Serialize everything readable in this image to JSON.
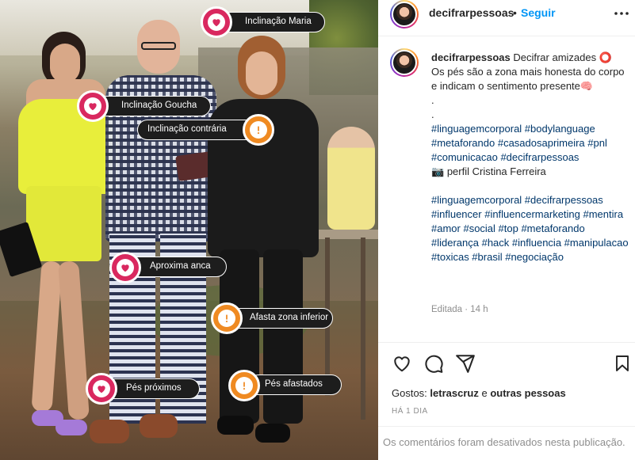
{
  "photo": {
    "tags": [
      {
        "label": "Inclinação Maria",
        "kind": "heart"
      },
      {
        "label": "Inclinação Goucha",
        "kind": "heart"
      },
      {
        "label": "Inclinação contrária",
        "kind": "alert"
      },
      {
        "label": "Aproxima anca",
        "kind": "heart"
      },
      {
        "label": "Afasta zona inferior",
        "kind": "alert"
      },
      {
        "label": "Pés próximos",
        "kind": "heart"
      },
      {
        "label": "Pés afastados",
        "kind": "alert"
      }
    ],
    "colors": {
      "heart": "#d9285f",
      "alert": "#ef8a22"
    }
  },
  "header": {
    "username": "decifrarpessoas",
    "separator": "•",
    "follow_label": "Seguir",
    "more_icon": "more-horizontal-icon"
  },
  "caption": {
    "username": "decifrarpessoas",
    "title": "Decifrar amizades",
    "title_emoji": "⭕",
    "body": "Os pés são a zona mais honesta do corpo e indicam o sentimento presente",
    "body_emoji": "🧠",
    "dots": ".\n.",
    "hashtags_1": "#linguagemcorporal #bodylanguage #metaforando #casadosaprimeira #pnl #comunicacao #decifrarpessoas",
    "credit_emoji": "📷",
    "credit": "perfil Cristina Ferreira",
    "hashtags_2": "#linguagemcorporal #decifrarpessoas #influencer #influencermarketing #mentira #amor #social #top #metaforando #liderança #hack #influencia #manipulacao #toxicas #brasil #negociação",
    "edited": "Editada · 14 h"
  },
  "actions": {
    "icons": [
      "heart-icon",
      "comment-icon",
      "share-icon",
      "bookmark-icon"
    ]
  },
  "likes": {
    "prefix": "Gostos:",
    "user": "letrascruz",
    "conj": "e",
    "others": "outras pessoas"
  },
  "time_ago": "HÁ 1 DIA",
  "comments_disabled": "Os comentários foram desativados nesta publicação."
}
